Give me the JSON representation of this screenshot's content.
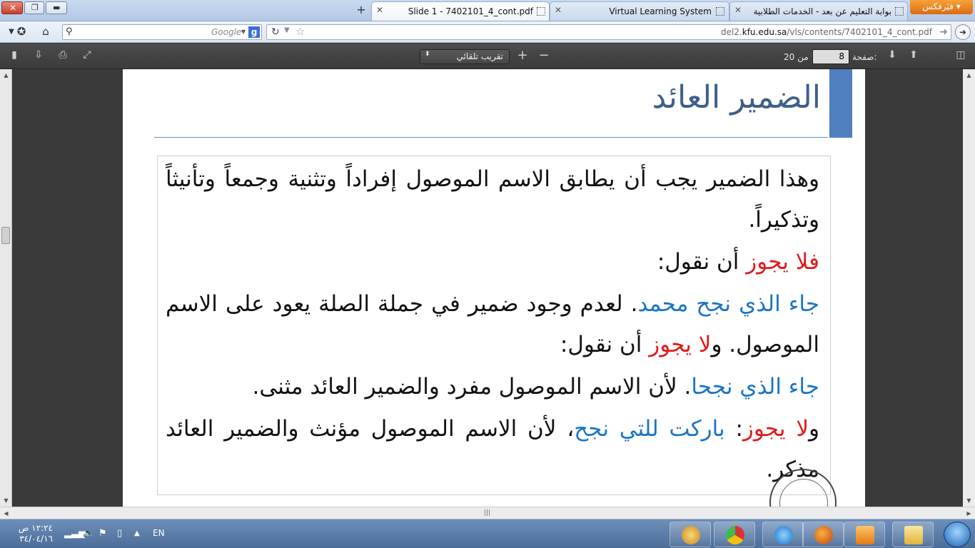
{
  "browser": {
    "firefox_button": "فيَرفكس ▾",
    "tabs": [
      {
        "label": "بوابة التعليم عن بعد - الخدمات الطلابية",
        "active": false
      },
      {
        "label": "Virtual Learning System",
        "active": false
      },
      {
        "label": "Slide 1 - 7402101_4_cont.pdf",
        "active": true
      }
    ],
    "new_tab": "+",
    "search_placeholder": "Google",
    "search_engine_letter": "g",
    "url_host": "kfu.edu.sa",
    "url_prefix": "del2.",
    "url_path": "/vls/contents/7402101_4_cont.pdf"
  },
  "pdf_toolbar": {
    "zoom_value": "تقريب تلقائي",
    "page_label": "صفحة:",
    "page_number": "8",
    "page_total": "من 20"
  },
  "slide": {
    "title": "الضمير العائد",
    "paragraph1": "وهذا الضمير يجب أن يطابق الاسم الموصول إفراداً وتثنية وجمعاً وتأنيثاً وتذكيراً.",
    "p2_red": "فلا يجوز",
    "p2_rest": " أن نقول:",
    "p3_blue": "جاء الذي نجح محمد",
    "p3_rest1": ". لعدم وجود ضمير في جملة الصلة يعود على الاسم الموصول. و",
    "p3_red": "لا يجوز",
    "p3_rest2": " أن نقول:",
    "p4_blue": "جاء الذي نجحا",
    "p4_rest": ". لأن الاسم الموصول مفرد والضمير العائد مثنى.",
    "p5_lead": "و",
    "p5_red": "لا يجوز",
    "p5_colon": ": ",
    "p5_blue": "باركت للتي نجح",
    "p5_rest": "، لأن الاسم الموصول مؤنث والضمير العائد مذكر."
  },
  "taskbar": {
    "time": "١٢:٢٤ ص",
    "date": "٣٤/٠٤/١٦",
    "language": "EN"
  },
  "colors": {
    "title": "#3f5f8a",
    "red": "#e01a1a",
    "blue": "#1a74c4",
    "accent": "#4f7fbf"
  }
}
